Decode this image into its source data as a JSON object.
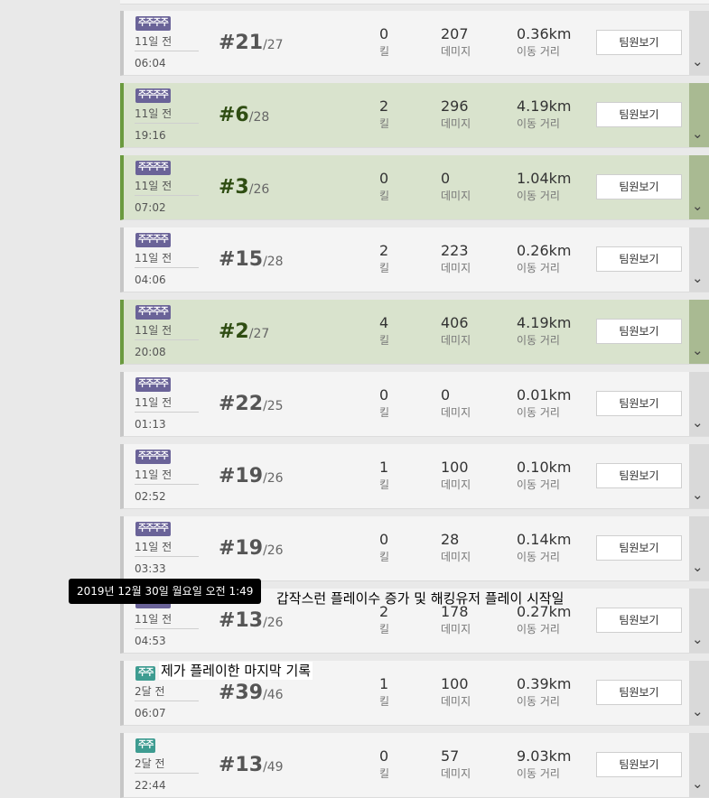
{
  "team_button_label": "팀원보기",
  "tooltip": "2019년 12월 30일 월요일 오전 1:49",
  "annotations": {
    "surge": "갑작스런 플레이수 증가 및 해킹유저 플레이 시작일",
    "last_record": "제가 플레이한 마지막 기록"
  },
  "matches": [
    {
      "mode": "squad",
      "badge": "주주주주",
      "ago": "11일 전",
      "time": "06:04",
      "rank": "#21",
      "total": "/27",
      "kills": "0",
      "damage": "207",
      "distance": "0.36km",
      "win": false
    },
    {
      "mode": "squad",
      "badge": "주주주주",
      "ago": "11일 전",
      "time": "19:16",
      "rank": "#6",
      "total": "/28",
      "kills": "2",
      "damage": "296",
      "distance": "4.19km",
      "win": true
    },
    {
      "mode": "squad",
      "badge": "주주주주",
      "ago": "11일 전",
      "time": "07:02",
      "rank": "#3",
      "total": "/26",
      "kills": "0",
      "damage": "0",
      "distance": "1.04km",
      "win": true
    },
    {
      "mode": "squad",
      "badge": "주주주주",
      "ago": "11일 전",
      "time": "04:06",
      "rank": "#15",
      "total": "/28",
      "kills": "2",
      "damage": "223",
      "distance": "0.26km",
      "win": false
    },
    {
      "mode": "squad",
      "badge": "주주주주",
      "ago": "11일 전",
      "time": "20:08",
      "rank": "#2",
      "total": "/27",
      "kills": "4",
      "damage": "406",
      "distance": "4.19km",
      "win": true
    },
    {
      "mode": "squad",
      "badge": "주주주주",
      "ago": "11일 전",
      "time": "01:13",
      "rank": "#22",
      "total": "/25",
      "kills": "0",
      "damage": "0",
      "distance": "0.01km",
      "win": false
    },
    {
      "mode": "squad",
      "badge": "주주주주",
      "ago": "11일 전",
      "time": "02:52",
      "rank": "#19",
      "total": "/26",
      "kills": "1",
      "damage": "100",
      "distance": "0.10km",
      "win": false
    },
    {
      "mode": "squad",
      "badge": "주주주주",
      "ago": "11일 전",
      "time": "03:33",
      "rank": "#19",
      "total": "/26",
      "kills": "0",
      "damage": "28",
      "distance": "0.14km",
      "win": false
    },
    {
      "mode": "squad",
      "badge": "주주주주",
      "ago": "11일 전",
      "time": "04:53",
      "rank": "#13",
      "total": "/26",
      "kills": "2",
      "damage": "178",
      "distance": "0.27km",
      "win": false
    },
    {
      "mode": "duo",
      "badge": "주주",
      "ago": "2달 전",
      "time": "06:07",
      "rank": "#39",
      "total": "/46",
      "kills": "1",
      "damage": "100",
      "distance": "0.39km",
      "win": false
    },
    {
      "mode": "duo",
      "badge": "주주",
      "ago": "2달 전",
      "time": "22:44",
      "rank": "#13",
      "total": "/49",
      "kills": "0",
      "damage": "57",
      "distance": "9.03km",
      "win": false
    }
  ],
  "labels": {
    "kills": "킬",
    "damage": "데미지",
    "distance": "이동 거리"
  },
  "icons": {
    "expand": "chevron-down-icon"
  }
}
